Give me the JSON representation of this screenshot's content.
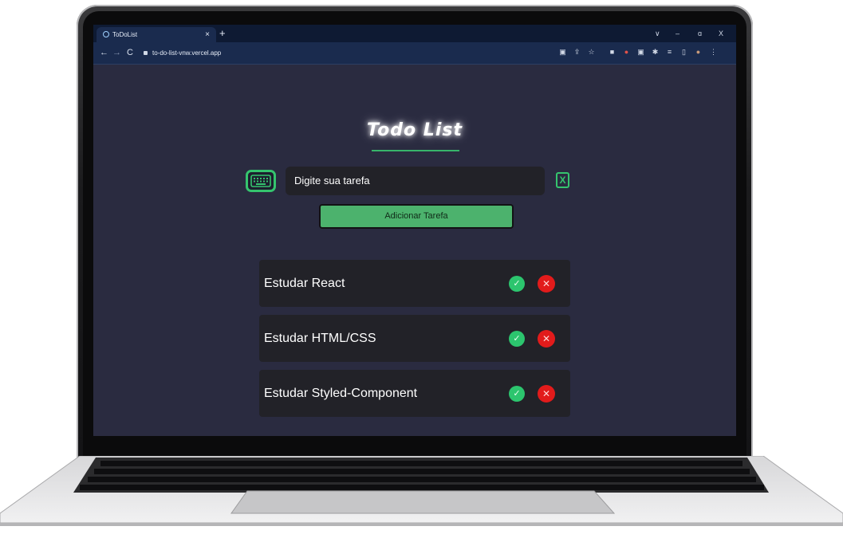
{
  "browser": {
    "tab_title": "ToDoList",
    "tab_close": "×",
    "new_tab": "+",
    "url": "to-do-list-vnw.vercel.app",
    "nav": {
      "back": "←",
      "forward": "→",
      "reload": "C"
    },
    "window_controls": {
      "dropdown": "∨",
      "minimize": "–",
      "restore": "ɑ",
      "close": "X"
    }
  },
  "app": {
    "title": "Todo List",
    "input_placeholder": "Digite sua tarefa",
    "clear_label": "X",
    "add_button": "Adicionar Tarefa",
    "tasks": [
      {
        "label": "Estudar React"
      },
      {
        "label": "Estudar HTML/CSS"
      },
      {
        "label": "Estudar Styled-Component"
      }
    ],
    "check_glyph": "✓",
    "delete_glyph": "✕"
  },
  "colors": {
    "background": "#2a2b40",
    "accent": "#35c46e",
    "add_button": "#4cb26d",
    "complete": "#2cc56e",
    "delete": "#e21b1b",
    "card": "#222228"
  },
  "icons": [
    "keyboard-icon",
    "clear-icon",
    "check-icon",
    "delete-icon",
    "lock-icon"
  ]
}
